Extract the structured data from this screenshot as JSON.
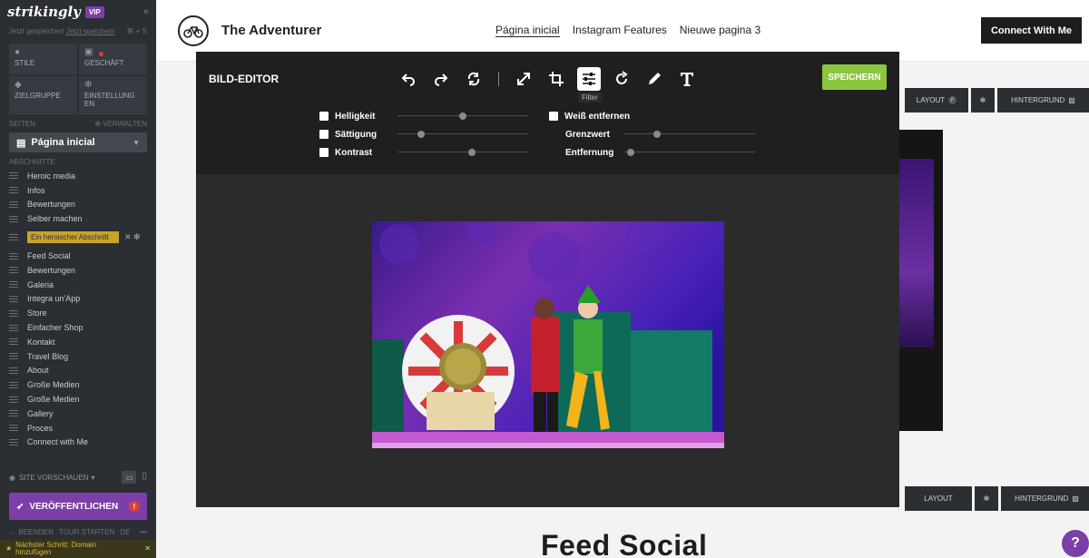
{
  "sidebar": {
    "logo": "strikingly",
    "vip": "VIP",
    "collapse_icon": "«",
    "save_hint": "Jetzt gespeichert",
    "save_link": "Jetzt speichern",
    "save_right": "⌘ + S",
    "tiles": [
      {
        "label": "STILE",
        "icon": "palette-icon"
      },
      {
        "label": "GESCHÄFT",
        "icon": "lock-icon"
      },
      {
        "label": "ZIELGRUPPE",
        "icon": "users-icon"
      },
      {
        "label": "EINSTELLUNG EN",
        "icon": "gear-icon"
      }
    ],
    "pages_label": "SEITEN",
    "manage_label": "VERWALTEN",
    "current_page": "Página inicial",
    "sections_label": "ABSCHNITTE",
    "sections": [
      "Heroic media",
      "Infos",
      "Bewertungen",
      "Selber machen",
      "Ein heroischer Abschnitt",
      "Feed Social",
      "Bewertungen",
      "Galeria",
      "Integra un'App",
      "Store",
      "Einfacher Shop",
      "Kontakt",
      "Travel Blog",
      "About",
      "Große Medien",
      "Große Medien",
      "Gallery",
      "Proces",
      "Connect with Me"
    ],
    "active_section_index": 4,
    "preview_label": "SITE VORSCHAUEN",
    "publish_label": "VERÖFFENTLICHEN",
    "publish_badge": "!",
    "tour_end": "BEENDEN",
    "tour_start": "TOUR STARTEN",
    "tour_lang": "DE",
    "next_step": "Nächster Schritt: Domain hinzufügen"
  },
  "site": {
    "title": "The Adventurer",
    "nav": [
      "Página inicial",
      "Instagram Features",
      "Nieuwe pagina 3"
    ],
    "connect_button": "Connect With Me",
    "layout_label": "LAYOUT",
    "background_label": "HINTERGRUND",
    "feed_title": "Feed Social",
    "help": "?"
  },
  "editor": {
    "title": "BILD-EDITOR",
    "save_label": "SPEICHERN",
    "tooltip": "Filter",
    "tools": [
      "undo-icon",
      "redo-icon",
      "reset-icon",
      "resize-icon",
      "crop-icon",
      "filter-icon",
      "rotate-icon",
      "pencil-icon",
      "text-icon"
    ],
    "filters_left": [
      {
        "label": "Helligkeit",
        "value": 0.5
      },
      {
        "label": "Sättigung",
        "value": 0.18
      },
      {
        "label": "Kontrast",
        "value": 0.57
      }
    ],
    "filter_right_checkbox": "Weiß entfernen",
    "filters_right": [
      {
        "label": "Grenzwert",
        "value": 0.25
      },
      {
        "label": "Entfernung",
        "value": 0.05
      }
    ],
    "accent_color": "#8cc63f"
  }
}
